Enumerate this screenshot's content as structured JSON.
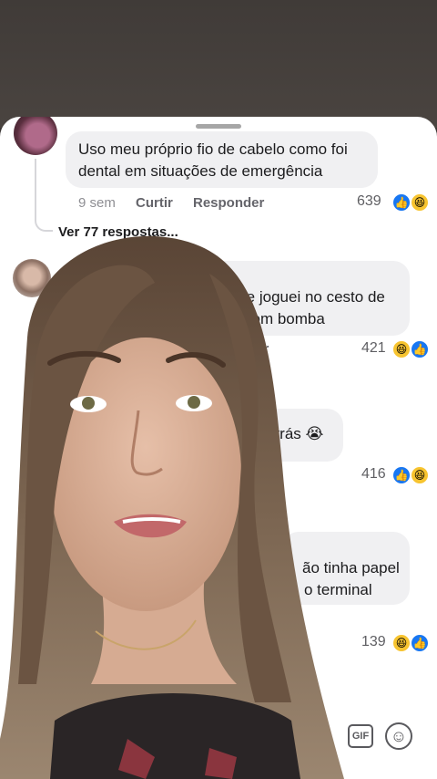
{
  "comments": [
    {
      "lines": [
        "Uso meu próprio fio de cabelo como foi",
        "dental em situações  de emergência"
      ],
      "time": "9 sem",
      "like_label": "Curtir",
      "reply_label": "Responder",
      "count": "639",
      "view_replies": "Ver 77 respostas..."
    },
    {
      "lines": [
        "so e joguei no cesto de",
        "com bomba"
      ],
      "reply_fragment": "der",
      "count": "421"
    },
    {
      "lines": [
        "atrás 😭"
      ],
      "count": "416"
    },
    {
      "lines": [
        "ão tinha papel",
        "o terminal"
      ],
      "count": "139"
    }
  ],
  "composer": {
    "gif_label": "GIF",
    "emoji_icon": "smiley-icon"
  },
  "colors": {
    "sheet": "#ffffff",
    "bubble": "#f0f0f2",
    "like_blue": "#1877f2",
    "haha_yellow": "#f7c430"
  }
}
